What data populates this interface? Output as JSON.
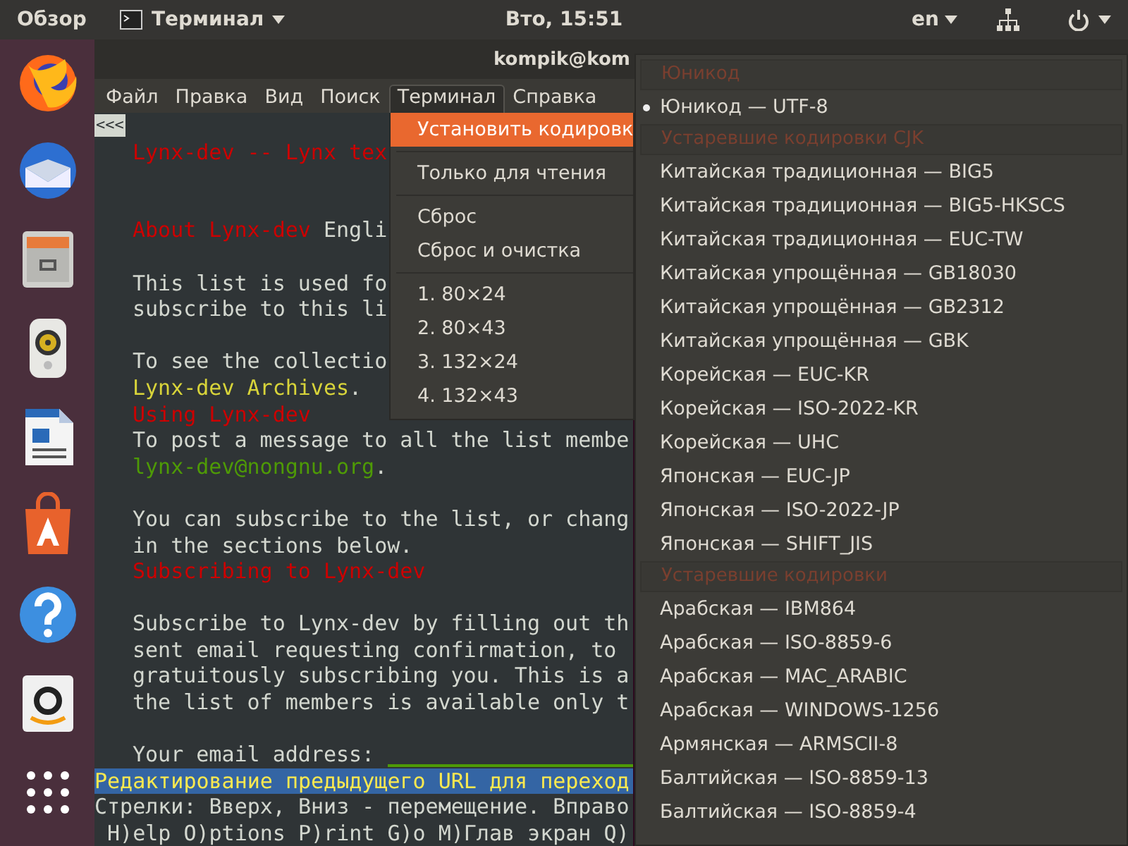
{
  "top_bar": {
    "activities": "Обзор",
    "app_menu": "Терминал",
    "clock": "Вто, 15:51",
    "keyboard_layout": "en"
  },
  "terminal": {
    "title": "kompik@kom",
    "menu_bar": [
      {
        "label": "Файл",
        "selected": false
      },
      {
        "label": "Правка",
        "selected": false
      },
      {
        "label": "Вид",
        "selected": false
      },
      {
        "label": "Поиск",
        "selected": false
      },
      {
        "label": "Терминал",
        "selected": true
      },
      {
        "label": "Справка",
        "selected": false
      }
    ],
    "marker": "<<<",
    "lines": [
      {
        "kind": "text",
        "segments": [
          {
            "kind": "heading",
            "text": "Lynx-dev -- Lynx tex"
          }
        ]
      },
      {
        "kind": "blank"
      },
      {
        "kind": "blank"
      },
      {
        "kind": "text",
        "segments": [
          {
            "kind": "heading",
            "text": "About Lynx-dev"
          },
          {
            "kind": "plain",
            "text": " Engli"
          }
        ]
      },
      {
        "kind": "blank"
      },
      {
        "kind": "text",
        "segments": [
          {
            "kind": "plain",
            "text": "This list is used fo"
          }
        ]
      },
      {
        "kind": "text",
        "segments": [
          {
            "kind": "plain",
            "text": "subscribe to this li"
          }
        ]
      },
      {
        "kind": "blank"
      },
      {
        "kind": "text",
        "segments": [
          {
            "kind": "plain",
            "text": "To see the collectio"
          }
        ]
      },
      {
        "kind": "text",
        "segments": [
          {
            "kind": "link",
            "text": "Lynx-dev Archives"
          },
          {
            "kind": "plain",
            "text": "."
          }
        ]
      },
      {
        "kind": "text",
        "segments": [
          {
            "kind": "heading",
            "text": "Using Lynx-dev"
          }
        ]
      },
      {
        "kind": "text",
        "segments": [
          {
            "kind": "plain",
            "text": "To post a message to all the list membe"
          }
        ]
      },
      {
        "kind": "text",
        "segments": [
          {
            "kind": "email",
            "text": "lynx-dev@nongnu.org"
          },
          {
            "kind": "plain",
            "text": "."
          }
        ]
      },
      {
        "kind": "blank"
      },
      {
        "kind": "text",
        "segments": [
          {
            "kind": "plain",
            "text": "You can subscribe to the list, or chang"
          }
        ]
      },
      {
        "kind": "text",
        "segments": [
          {
            "kind": "plain",
            "text": "in the sections below."
          }
        ]
      },
      {
        "kind": "text",
        "segments": [
          {
            "kind": "heading",
            "text": "Subscribing to Lynx-dev"
          }
        ]
      },
      {
        "kind": "blank"
      },
      {
        "kind": "text",
        "segments": [
          {
            "kind": "plain",
            "text": "Subscribe to Lynx-dev by filling out th"
          }
        ]
      },
      {
        "kind": "text",
        "segments": [
          {
            "kind": "plain",
            "text": "sent email requesting confirmation, to"
          }
        ]
      },
      {
        "kind": "text",
        "segments": [
          {
            "kind": "plain",
            "text": "gratuitously subscribing you. This is a"
          }
        ]
      },
      {
        "kind": "text",
        "segments": [
          {
            "kind": "plain",
            "text": "the list of members is available only t"
          }
        ]
      },
      {
        "kind": "blank"
      },
      {
        "kind": "text",
        "segments": [
          {
            "kind": "plain",
            "text": "Your email address:"
          },
          {
            "kind": "field"
          }
        ]
      }
    ],
    "status_lines": [
      {
        "kind": "prompt",
        "text": "Редактирование предыдущего URL для переход"
      },
      {
        "kind": "hint",
        "text": "Стрелки: Вверх, Вниз - перемещение. Вправо"
      },
      {
        "kind": "hint",
        "text": " H)elp O)ptions P)rint G)o M)Глав экран Q)"
      }
    ]
  },
  "terminal_menu": {
    "items": [
      {
        "kind": "item",
        "label": "Установить кодировк",
        "selected": true
      },
      {
        "kind": "separator"
      },
      {
        "kind": "item",
        "label": "Только для чтения",
        "selected": false
      },
      {
        "kind": "separator"
      },
      {
        "kind": "item",
        "label": "Сброс",
        "selected": false
      },
      {
        "kind": "item",
        "label": "Сброс и очистка",
        "selected": false
      },
      {
        "kind": "separator"
      },
      {
        "kind": "item",
        "label": "1. 80×24",
        "selected": false
      },
      {
        "kind": "item",
        "label": "2. 80×43",
        "selected": false
      },
      {
        "kind": "item",
        "label": "3. 132×24",
        "selected": false
      },
      {
        "kind": "item",
        "label": "4. 132×43",
        "selected": false
      }
    ]
  },
  "encoding_submenu": {
    "items": [
      {
        "kind": "header",
        "label": "Юникод"
      },
      {
        "kind": "radio",
        "label": "Юникод — UTF-8",
        "selected": true
      },
      {
        "kind": "header",
        "label": "Устаревшие кодировки CJK"
      },
      {
        "kind": "radio",
        "label": "Китайская традиционная — BIG5",
        "selected": false
      },
      {
        "kind": "radio",
        "label": "Китайская традиционная — BIG5-HKSCS",
        "selected": false
      },
      {
        "kind": "radio",
        "label": "Китайская традиционная — EUC-TW",
        "selected": false
      },
      {
        "kind": "radio",
        "label": "Китайская упрощённая — GB18030",
        "selected": false
      },
      {
        "kind": "radio",
        "label": "Китайская упрощённая — GB2312",
        "selected": false
      },
      {
        "kind": "radio",
        "label": "Китайская упрощённая — GBK",
        "selected": false
      },
      {
        "kind": "radio",
        "label": "Корейская — EUC-KR",
        "selected": false
      },
      {
        "kind": "radio",
        "label": "Корейская — ISO-2022-KR",
        "selected": false
      },
      {
        "kind": "radio",
        "label": "Корейская — UHC",
        "selected": false
      },
      {
        "kind": "radio",
        "label": "Японская — EUC-JP",
        "selected": false
      },
      {
        "kind": "radio",
        "label": "Японская — ISO-2022-JP",
        "selected": false
      },
      {
        "kind": "radio",
        "label": "Японская — SHIFT_JIS",
        "selected": false
      },
      {
        "kind": "header",
        "label": "Устаревшие кодировки"
      },
      {
        "kind": "radio",
        "label": "Арабская — IBM864",
        "selected": false
      },
      {
        "kind": "radio",
        "label": "Арабская — ISO-8859-6",
        "selected": false
      },
      {
        "kind": "radio",
        "label": "Арабская — MAC_ARABIC",
        "selected": false
      },
      {
        "kind": "radio",
        "label": "Арабская — WINDOWS-1256",
        "selected": false
      },
      {
        "kind": "radio",
        "label": "Армянская — ARMSCII-8",
        "selected": false
      },
      {
        "kind": "radio",
        "label": "Балтийская — ISO-8859-13",
        "selected": false
      },
      {
        "kind": "radio",
        "label": "Балтийская — ISO-8859-4",
        "selected": false
      }
    ]
  }
}
